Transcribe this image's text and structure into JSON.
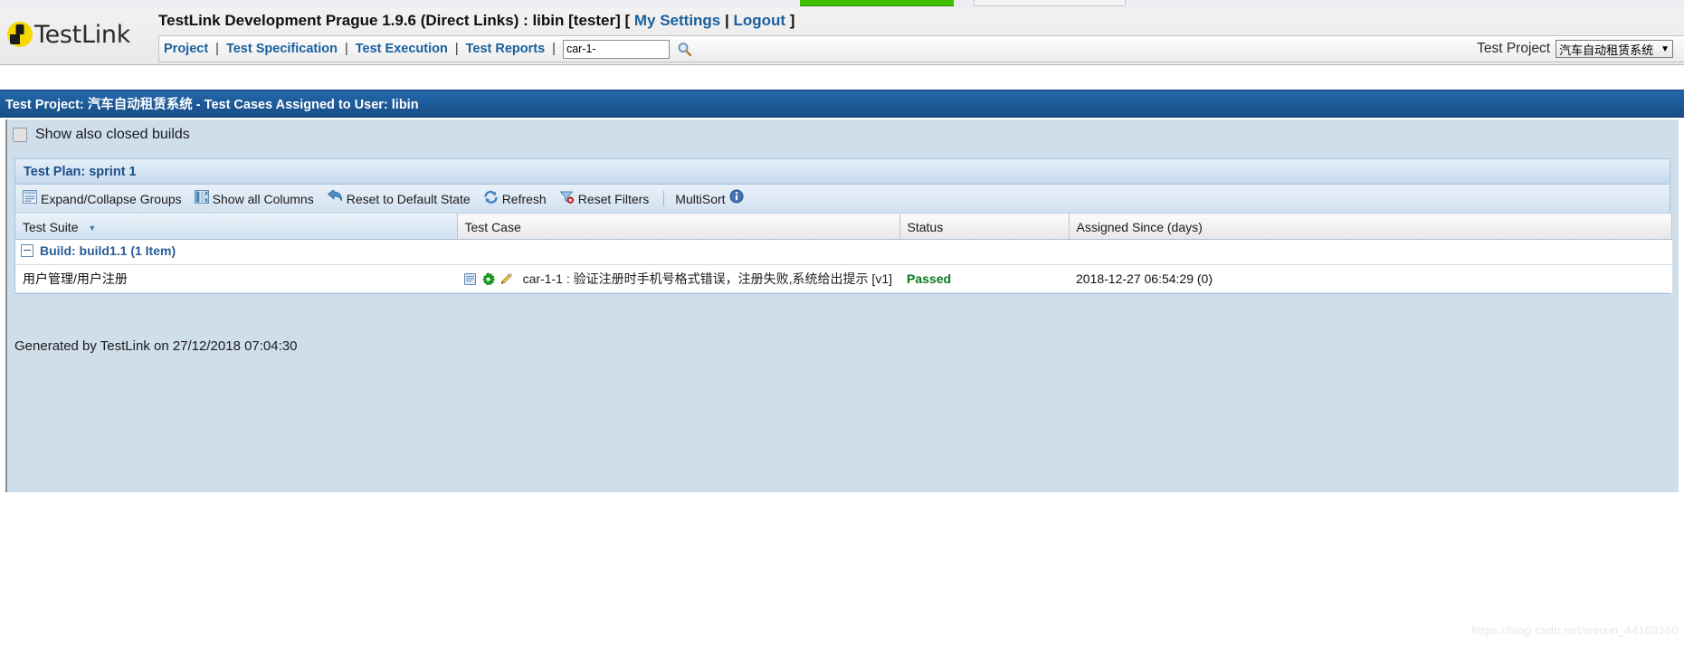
{
  "browser": {
    "green_tab": "",
    "grey_tab": ""
  },
  "header": {
    "logo_text": "TestLink",
    "title_prefix": "TestLink Development Prague 1.9.6 (Direct Links) : libin [tester] [ ",
    "my_settings": "My Settings",
    "sep1": " | ",
    "logout": "Logout",
    "title_suffix": " ]",
    "menu": [
      {
        "label": "Project",
        "name": "menu-project"
      },
      {
        "label": "Test Specification",
        "name": "menu-test-specification"
      },
      {
        "label": "Test Execution",
        "name": "menu-test-execution"
      },
      {
        "label": "Test Reports",
        "name": "menu-test-reports"
      }
    ],
    "menu_separator": "|",
    "search_value": "car-1-",
    "search_placeholder": "",
    "search_icon": "magnifier-icon",
    "test_project_label": "Test Project",
    "test_project_selected": "汽车自动租赁系统",
    "test_project_arrow": "▼"
  },
  "page_title": "Test Project: 汽车自动租赁系统 - Test Cases Assigned to User: libin",
  "filters": {
    "show_closed_builds_label": "Show also closed builds",
    "show_closed_builds_checked": false
  },
  "plan": {
    "header": "Test Plan: sprint 1",
    "toolbar": [
      {
        "label": "Expand/Collapse Groups",
        "icon": "expand-collapse-icon",
        "name": "expand-collapse-groups"
      },
      {
        "label": "Show all Columns",
        "icon": "columns-icon",
        "name": "show-all-columns"
      },
      {
        "label": "Reset to Default State",
        "icon": "undo-arrow-icon",
        "name": "reset-default-state"
      },
      {
        "label": "Refresh",
        "icon": "refresh-icon",
        "name": "refresh"
      },
      {
        "label": "Reset Filters",
        "icon": "filter-reset-icon",
        "name": "reset-filters"
      }
    ],
    "multisort_label": "MultiSort",
    "multisort_icon": "info-icon"
  },
  "table": {
    "columns": [
      {
        "label": "Test Suite",
        "sorted": true,
        "sort_dir": "▼"
      },
      {
        "label": "Test Case",
        "sorted": false,
        "sort_dir": ""
      },
      {
        "label": "Status",
        "sorted": false,
        "sort_dir": ""
      },
      {
        "label": "Assigned Since (days)",
        "sorted": false,
        "sort_dir": ""
      }
    ],
    "groups": [
      {
        "label": "Build: build1.1 (1 Item)",
        "expanded": true,
        "rows": [
          {
            "test_suite": "用户管理/用户注册",
            "test_case_id": "car-1-1",
            "test_case_sep": " : ",
            "test_case_title": "验证注册时手机号格式错误，注册失败,系统给出提示 [v1]",
            "icons": [
              "notepad-icon",
              "gear-icon",
              "pencil-icon"
            ],
            "status": "Passed",
            "status_color": "#0a7a1e",
            "assigned_since": "2018-12-27 06:54:29 (0)"
          }
        ]
      }
    ]
  },
  "footer": {
    "generated": "Generated by TestLink on 27/12/2018 07:04:30"
  },
  "watermark": "https://blog.csdn.net/weixin_44169160",
  "colors": {
    "title_bar": "#1f5fa0",
    "panel_bg": "#cfdeeb",
    "link": "#1a5f9e",
    "passed": "#0a7a1e"
  }
}
